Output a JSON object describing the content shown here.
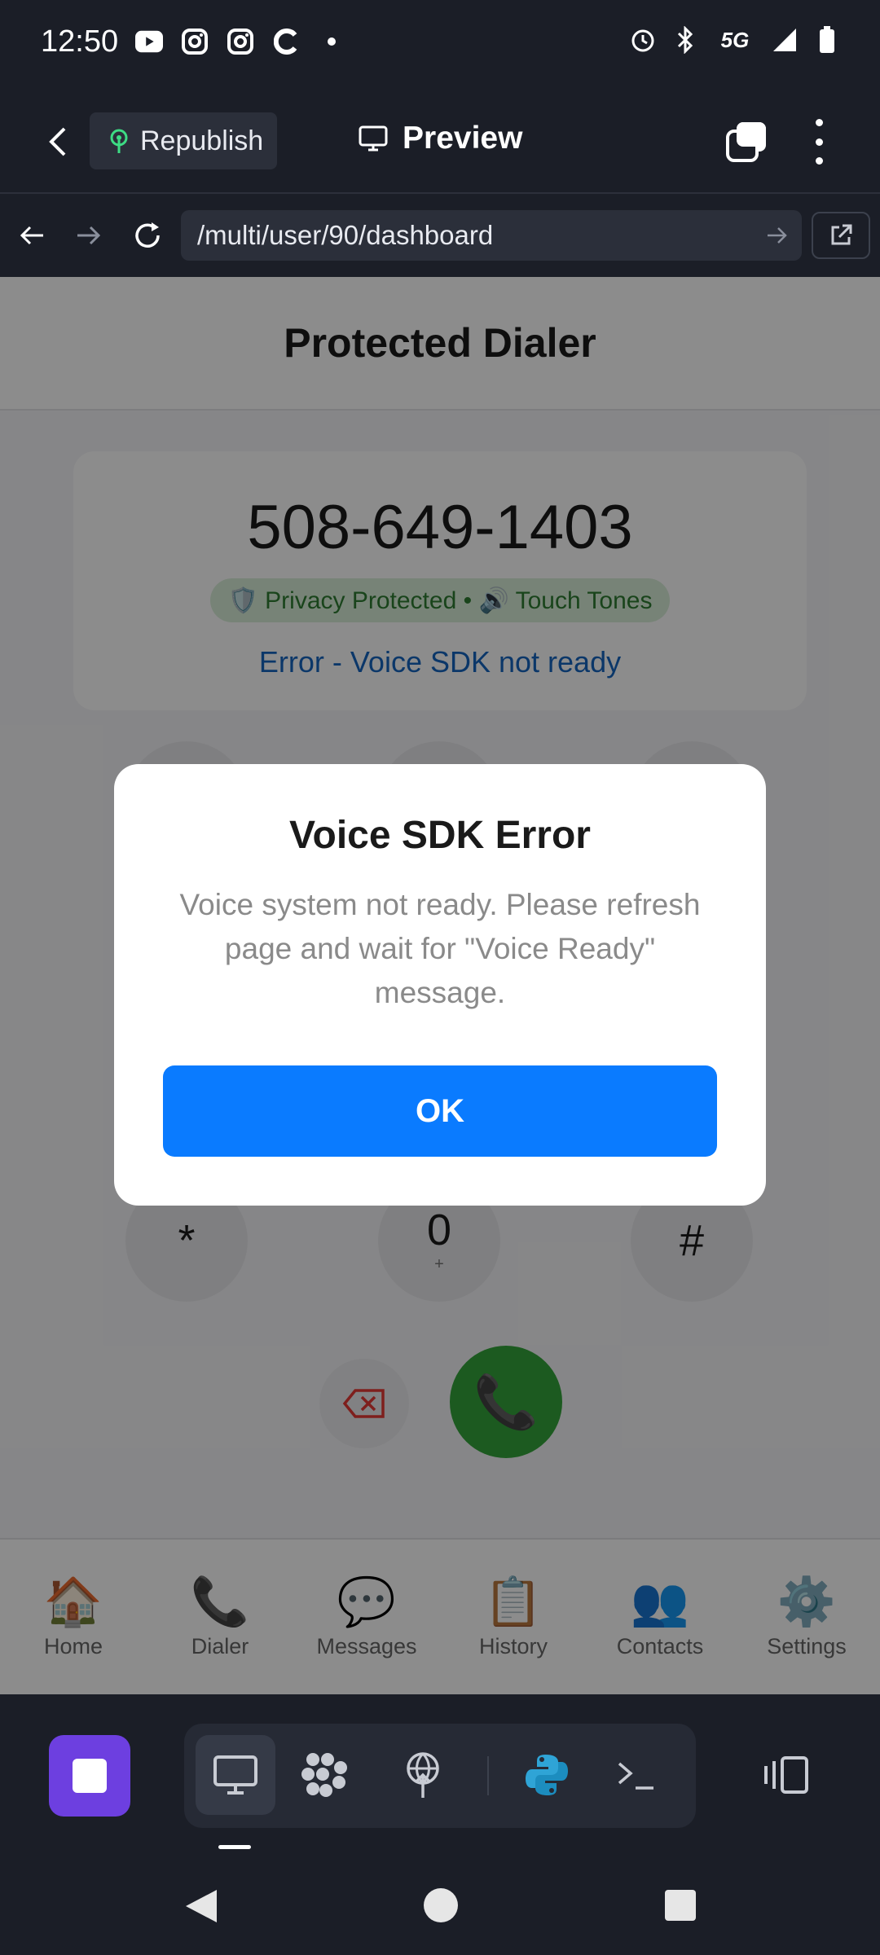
{
  "status_bar": {
    "time": "12:50",
    "network": "5G",
    "left_icons": [
      "youtube-icon",
      "instagram-icon",
      "instagram-icon",
      "c-app-icon",
      "dot-icon"
    ],
    "right_icons": [
      "alarm-icon",
      "bluetooth-icon",
      "5g-icon",
      "signal-icon",
      "battery-icon"
    ]
  },
  "app_header": {
    "republish_label": "Republish",
    "preview_label": "Preview"
  },
  "url_bar": {
    "url": "/multi/user/90/dashboard"
  },
  "page": {
    "title": "Protected Dialer",
    "phone_number": "508-649-1403",
    "privacy_badge": "🛡️ Privacy Protected • 🔊 Touch Tones",
    "status": "Error - Voice SDK not ready",
    "keypad_bottom_row": [
      {
        "digit": "*",
        "sub": ""
      },
      {
        "digit": "0",
        "sub": "+"
      },
      {
        "digit": "#",
        "sub": ""
      }
    ],
    "call_icon": "📞"
  },
  "tabbar": {
    "items": [
      {
        "icon": "🏠",
        "label": "Home"
      },
      {
        "icon": "📞",
        "label": "Dialer"
      },
      {
        "icon": "💬",
        "label": "Messages"
      },
      {
        "icon": "📋",
        "label": "History"
      },
      {
        "icon": "👥",
        "label": "Contacts"
      },
      {
        "icon": "⚙️",
        "label": "Settings"
      }
    ]
  },
  "modal": {
    "title": "Voice SDK Error",
    "message": "Voice system not ready. Please refresh page and wait for \"Voice Ready\" message.",
    "ok_label": "OK"
  },
  "colors": {
    "primary_button": "#0a7bff",
    "call_button": "#34a53b",
    "status_error_text": "#1565c0",
    "badge_bg": "#d9efd9",
    "badge_text": "#2e7d32",
    "dock_app": "#6d3fe0"
  }
}
